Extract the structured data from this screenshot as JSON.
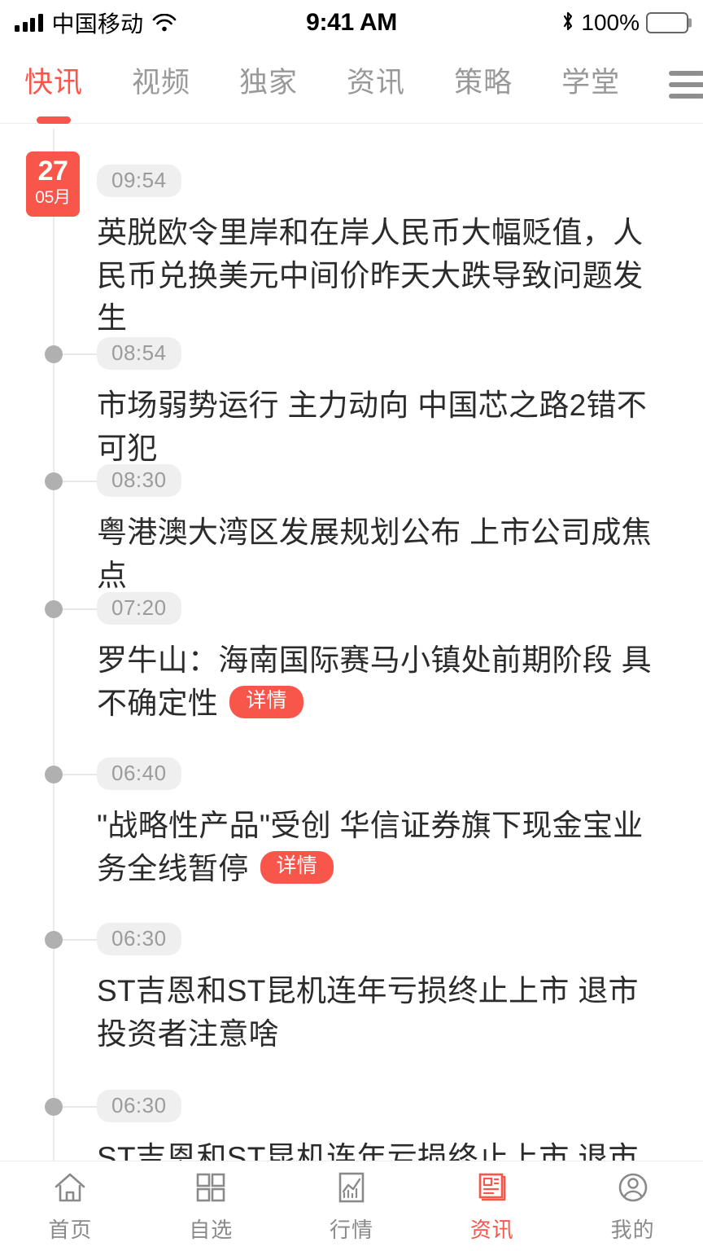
{
  "status_bar": {
    "carrier": "中国移动",
    "time": "9:41 AM",
    "battery_percent": "100%",
    "signal_icon": "signal-bars-icon",
    "wifi_icon": "wifi-icon",
    "bluetooth_icon": "bluetooth-icon",
    "battery_icon": "battery-full-icon"
  },
  "top_tabs": {
    "items": [
      {
        "label": "快讯",
        "active": true
      },
      {
        "label": "视频",
        "active": false
      },
      {
        "label": "独家",
        "active": false
      },
      {
        "label": "资讯",
        "active": false
      },
      {
        "label": "策略",
        "active": false
      },
      {
        "label": "学堂",
        "active": false
      }
    ],
    "menu_icon": "hamburger-menu-icon"
  },
  "feed": {
    "date_badge": {
      "day": "27",
      "month": "05月"
    },
    "detail_label": "详情",
    "items": [
      {
        "time": "09:54",
        "headline": "英脱欧令里岸和在岸人民币大幅贬值，人民币兑换美元中间价昨天大跌导致问题发生",
        "has_detail": false,
        "marker": "date-badge"
      },
      {
        "time": "08:54",
        "headline": "市场弱势运行 主力动向 中国芯之路2错不可犯",
        "has_detail": false,
        "marker": "dot"
      },
      {
        "time": "08:30",
        "headline": "粤港澳大湾区发展规划公布 上市公司成焦点",
        "has_detail": false,
        "marker": "dot"
      },
      {
        "time": "07:20",
        "headline": "罗牛山：海南国际赛马小镇处前期阶段  具不确定性",
        "has_detail": true,
        "marker": "dot"
      },
      {
        "time": "06:40",
        "headline": "\"战略性产品\"受创  华信证券旗下现金宝业务全线暂停",
        "has_detail": true,
        "marker": "dot"
      },
      {
        "time": "06:30",
        "headline": "ST吉恩和ST昆机连年亏损终止上市 退市投资者注意啥",
        "has_detail": false,
        "marker": "dot"
      },
      {
        "time": "06:30",
        "headline": "ST吉恩和ST昆机连年亏损终止上市 退市投资者",
        "has_detail": false,
        "marker": "dot"
      }
    ]
  },
  "bottom_nav": {
    "items": [
      {
        "label": "首页",
        "icon": "home-icon",
        "active": false
      },
      {
        "label": "自选",
        "icon": "grid-icon",
        "active": false
      },
      {
        "label": "行情",
        "icon": "chart-icon",
        "active": false
      },
      {
        "label": "资讯",
        "icon": "news-document-icon",
        "active": true
      },
      {
        "label": "我的",
        "icon": "user-profile-icon",
        "active": false
      }
    ]
  },
  "colors": {
    "accent_red": "#f8564b",
    "text_primary": "#2b2b2b",
    "text_muted": "#999999",
    "pill_bg": "#efefef",
    "timeline_line": "#ebebeb",
    "dot": "#b0b0b0"
  }
}
